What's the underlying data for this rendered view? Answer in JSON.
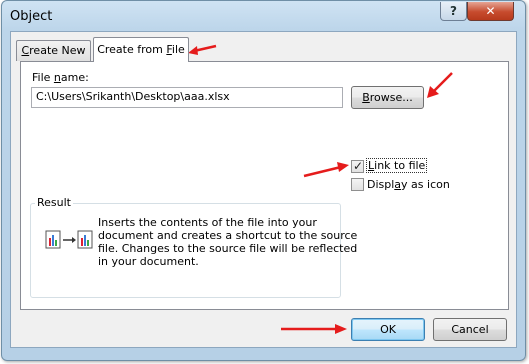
{
  "window": {
    "title": "Object",
    "help_label": "?",
    "close_label": "✕"
  },
  "tabs": [
    {
      "pre": "",
      "u": "C",
      "post": "reate New"
    },
    {
      "pre": "Create from ",
      "u": "F",
      "post": "ile"
    }
  ],
  "file": {
    "label_pre": "File ",
    "label_u": "n",
    "label_post": "ame:",
    "value": "C:\\Users\\Srikanth\\Desktop\\aaa.xlsx",
    "browse_u": "B",
    "browse_post": "rowse..."
  },
  "options": {
    "link_u": "L",
    "link_post": "ink to file",
    "link_checked": true,
    "link_mark": "✓",
    "display_pre": "Displ",
    "display_u": "a",
    "display_post": "y as icon",
    "display_checked": false
  },
  "result": {
    "legend": "Result",
    "lines": [
      "Inserts the contents of the file into your",
      "document and creates a shortcut to the source",
      "file.  Changes to the source file will be reflected",
      "in your document."
    ]
  },
  "footer": {
    "ok_label": "OK",
    "cancel_label": "Cancel"
  },
  "icons": [
    "help-icon",
    "close-icon",
    "checkbox-check-icon",
    "link-to-file-icon",
    "red-arrow-icon"
  ],
  "colors": {
    "annotation_arrow": "#e51c1c",
    "ok_border": "#3c7fb1"
  }
}
